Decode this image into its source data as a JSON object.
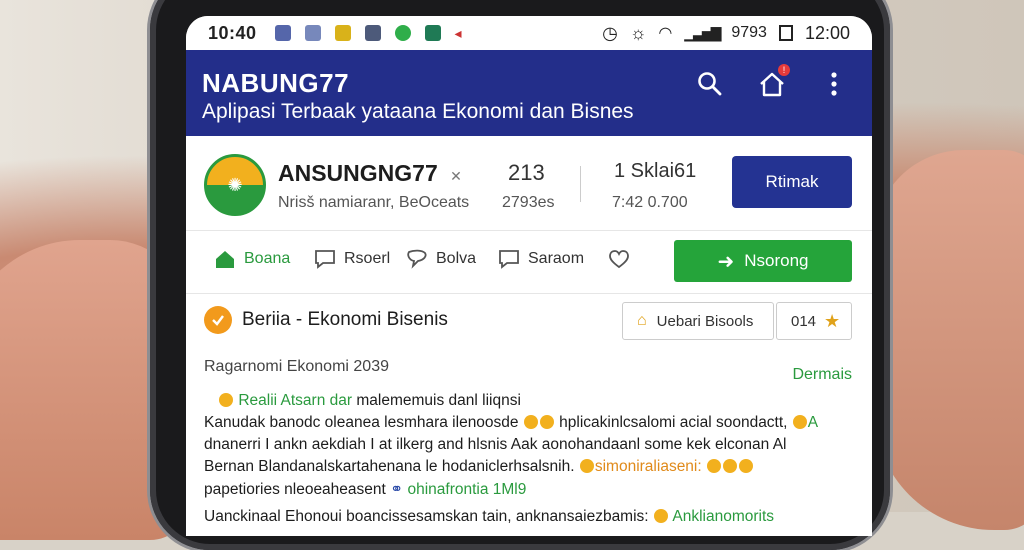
{
  "status_bar": {
    "time_left": "10:40",
    "battery_text": "9793",
    "time_right": "12:00"
  },
  "app_bar": {
    "title": "NABUNG77",
    "subtitle": "Aplipasi Terbaak yataana Ekonomi dan Bisnes"
  },
  "profile": {
    "name": "ANSUNGNG77",
    "name_suffix": "✕",
    "description": "Nrisš namiaranr, BeOceats",
    "stat1_value": "213",
    "stat1_label": "2793es",
    "stat2_value": "1 Sklai61",
    "stat2_label": "7:42 0.700",
    "follow_button": "Rtimak"
  },
  "tabs": [
    {
      "label": "Boana"
    },
    {
      "label": "Rsoerl"
    },
    {
      "label": "Bolva"
    },
    {
      "label": "Saraom"
    }
  ],
  "green_action": "Nsorong",
  "section": {
    "title": "Beriia - Ekonomi Bisenis",
    "button1": "Uebari Bisools",
    "button2": "014",
    "meta": "Ragarnomi Ekonomi 2039",
    "more_link": "Dermais",
    "lines": [
      {
        "green": "Realii Atsarn dar",
        "text": " malememuis danl liiqnsi"
      },
      {
        "text": "Kanudak banodc oleanea lesmhara ilenoosde",
        "text2": " hplicakinlcsalomi acial soondactt,",
        "green": "A"
      },
      {
        "text": "dnanerri I ankn aekdiah I at ilkerg and hlsnis Aak aonohandaanl some kek elconan Al",
        "orange": ""
      },
      {
        "text": "Bernan Blandanalskartahenana le hodaniclerhsalsnih.",
        "orange": "simoniraliaseni:",
        "text2": ""
      },
      {
        "text": "papetiories nleoeaheasent",
        "green": "ohinafrontia 1Ml9",
        "text2": ""
      },
      {
        "text": "Uanckinaal Ehonoui boancissesamskan tain, anknansaiezbamis:",
        "green": "Anklianomorits"
      }
    ]
  },
  "colors": {
    "app_bar": "#232e8a",
    "accent_green": "#25a43a",
    "follow_button": "#243392",
    "section_icon": "#f29a1c"
  }
}
